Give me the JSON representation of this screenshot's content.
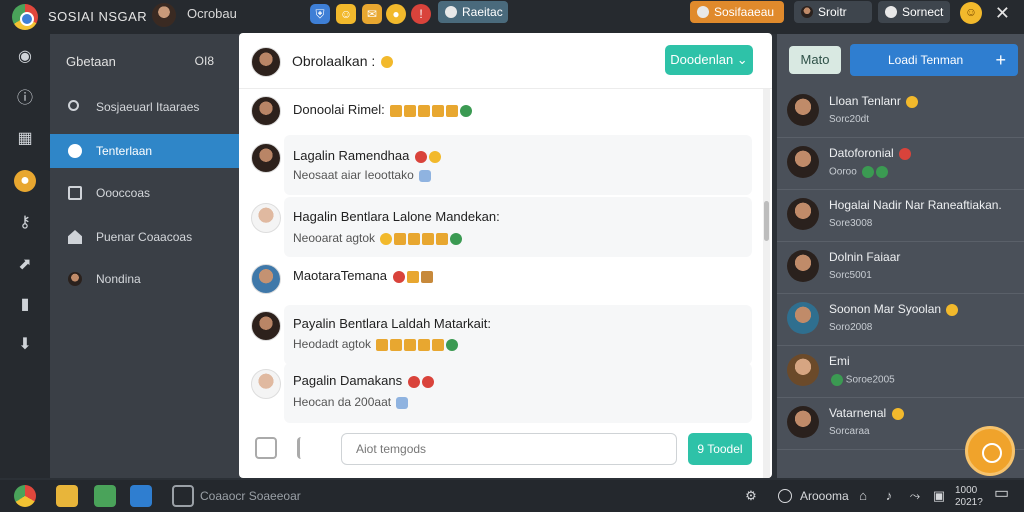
{
  "topbar": {
    "app_title": "SOSIAI NSGAR",
    "user_name": "Ocrobau",
    "btn_search": "Raeitac",
    "btn_orange": "Sosifaaeau",
    "profile_label": "Sroitr",
    "btn_settings": "Sornect",
    "colors": {
      "orange": "#e08a2c",
      "teal_btn": "#4a6a7c"
    }
  },
  "sidebar": {
    "title": "Gbetaan",
    "count": "OI8",
    "items": [
      {
        "label": "Sosjaeuarl Itaaraes",
        "icon": "search-icon"
      },
      {
        "label": "Tenterlaan",
        "icon": "chat-bubble-icon",
        "active": true
      },
      {
        "label": "Oooccoas",
        "icon": "folder-icon"
      },
      {
        "label": "Puenar Coaacoas",
        "icon": "home-icon"
      },
      {
        "label": "Nondina",
        "icon": "user-icon"
      }
    ]
  },
  "chat": {
    "title": "Obrolaalkan :",
    "header_button": "Doodenlan ⌄",
    "messages": [
      {
        "name": "Donoolai Rimel:",
        "sub": ""
      },
      {
        "name": "Lagalin Ramendhaa",
        "sub": "Neosaat aiar Ieoottako"
      },
      {
        "name": "Hagalin Bentlara Lalone Mandekan:",
        "sub": "Neooarat agtok"
      },
      {
        "name": "MaotaraTemana",
        "sub": ""
      },
      {
        "name": "Payalin Bentlara Laldah Matarkait:",
        "sub": "Heodadt agtok"
      },
      {
        "name": "Pagalin Damakans",
        "sub": "Heocan da 200aat"
      }
    ],
    "input_placeholder": "Aiot temgods",
    "send_label": "9 Toodel"
  },
  "right_panel": {
    "btn_left": "Mato",
    "btn_main": "Loadi Tenman",
    "btn_plus": "+",
    "friends": [
      {
        "name": "Lloan Tenlanr",
        "sub": "Sorc20dt"
      },
      {
        "name": "Datoforonial",
        "sub": "Ooroo"
      },
      {
        "name": "Hogalai Nadir Nar Raneaftiakan.",
        "sub": "Sore3008"
      },
      {
        "name": "Dolnin Faiaar",
        "sub": "Sorc5001"
      },
      {
        "name": "Soonon Mar Syoolan",
        "sub": "Soro2008"
      },
      {
        "name": "Emi",
        "sub": "Soroe2005"
      },
      {
        "name": "Vatarnenal",
        "sub": "Sorcaraa"
      }
    ]
  },
  "taskbar": {
    "label": "Coaaocr Soaeeoar",
    "tray_text": "Aroooma",
    "clock_time": "1000",
    "clock_date": "2021?"
  }
}
